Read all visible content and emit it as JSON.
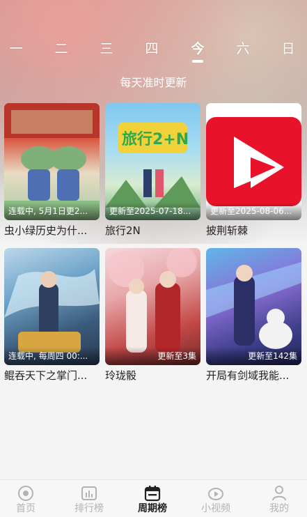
{
  "days": [
    "一",
    "二",
    "三",
    "四",
    "今",
    "六",
    "日"
  ],
  "active_day_index": 4,
  "subtitle": "每天准时更新",
  "cards": [
    {
      "caption": "连载中, 5月1日更2...",
      "title": "虫小绿历史为什...",
      "caption_align": "left"
    },
    {
      "caption": "更新至2025-07-18...",
      "title": "旅行2N",
      "caption_align": "left",
      "poster_text": "旅行2+N"
    },
    {
      "caption": "更新至2025-08-06...",
      "title": "披荆斩棘",
      "caption_align": "left"
    },
    {
      "caption": "连载中, 每周四 00:...",
      "title": "鲲吞天下之掌门...",
      "caption_align": "left"
    },
    {
      "caption": "更新至3集",
      "title": "玲珑骰",
      "caption_align": "right"
    },
    {
      "caption": "更新至142集",
      "title": "开局有剑域我能...",
      "caption_align": "right"
    }
  ],
  "nav": [
    {
      "label": "首页",
      "icon": "home-icon"
    },
    {
      "label": "排行榜",
      "icon": "ranking-icon"
    },
    {
      "label": "周期榜",
      "icon": "calendar-icon"
    },
    {
      "label": "小视频",
      "icon": "short-video-icon"
    },
    {
      "label": "我的",
      "icon": "profile-icon"
    }
  ],
  "active_nav_index": 2,
  "colors": {
    "accent_red": "#e8132a",
    "nav_inactive": "#b3b3b3",
    "nav_active": "#222222"
  }
}
